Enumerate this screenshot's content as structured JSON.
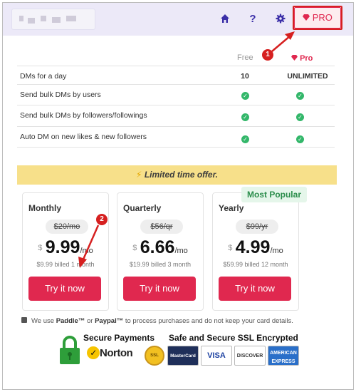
{
  "header": {
    "nav_icons": [
      "home-icon",
      "help-icon",
      "gear-icon"
    ],
    "help_glyph": "?",
    "pro_button": "PRO"
  },
  "table": {
    "col_free": "Free",
    "col_pro": "Pro",
    "rows": [
      {
        "label": "DMs for a day",
        "free": "10",
        "pro": "UNLIMITED"
      },
      {
        "label": "Send bulk DMs by users",
        "free": "check",
        "pro": "check"
      },
      {
        "label": "Send bulk DMs by followers/followings",
        "free": "check",
        "pro": "check"
      },
      {
        "label": "Auto DM on new likes & new followers",
        "free": "check",
        "pro": "check"
      }
    ]
  },
  "offer": {
    "icon": "lightning-icon",
    "text": "Limited time offer."
  },
  "popular_badge": "Most Popular",
  "plans": [
    {
      "name": "Monthly",
      "old": "$20/mo",
      "currency": "$",
      "price": "9.99",
      "per": "/mo",
      "billed": "$9.99 billed 1 month",
      "button": "Try it now"
    },
    {
      "name": "Quarterly",
      "old": "$56/qr",
      "currency": "$",
      "price": "6.66",
      "per": "/mo",
      "billed": "$19.99 billed 3 month",
      "button": "Try it now"
    },
    {
      "name": "Yearly",
      "old": "$99/yr",
      "currency": "$",
      "price": "4.99",
      "per": "/mo",
      "billed": "$59.99 billed 12 month",
      "button": "Try it now"
    }
  ],
  "annotations": {
    "one": "1",
    "two": "2"
  },
  "footer": {
    "note_pre": "We use ",
    "paddle": "Paddle™",
    "note_or": " or ",
    "paypal": "Paypal™",
    "note_post": " to process purchases and do not keep your card details.",
    "secure_payments": "Secure Payments",
    "ssl": "Safe and Secure SSL Encrypted",
    "norton": "Norton",
    "seal": "SSL",
    "cards": [
      "MasterCard",
      "VISA",
      "DISCOVER",
      "AMERICAN EXPRESS"
    ]
  },
  "colors": {
    "accent": "#e0284f",
    "nav": "#3b2fa8",
    "offer": "#f7e08a",
    "check": "#33b76a",
    "annotation": "#d62020"
  }
}
